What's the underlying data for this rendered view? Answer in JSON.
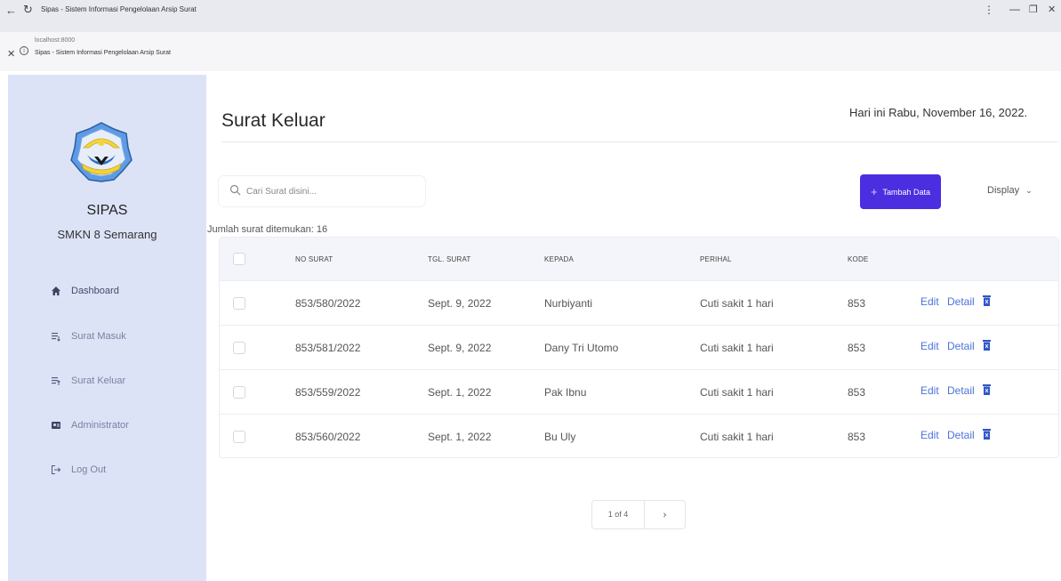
{
  "browser": {
    "tab_title": "Sipas - Sistem Informasi Pengelolaan Arsip Surat",
    "url": "localhost:8000",
    "page_title": "Sipas - Sistem Informasi Pengelolaan Arsip Surat"
  },
  "sidebar": {
    "brand": "SIPAS",
    "school": "SMKN 8 Semarang",
    "items": [
      {
        "label": "Dashboard",
        "icon": "home-icon"
      },
      {
        "label": "Surat Masuk",
        "icon": "inbox-list-icon"
      },
      {
        "label": "Surat Keluar",
        "icon": "outbox-list-icon"
      },
      {
        "label": "Administrator",
        "icon": "admin-icon"
      },
      {
        "label": "Log Out",
        "icon": "logout-icon"
      }
    ]
  },
  "main": {
    "title": "Surat Keluar",
    "date_text": "Hari ini Rabu, November 16, 2022.",
    "search_placeholder": "Cari Surat disini...",
    "add_button": "Tambah Data",
    "display_button": "Display",
    "count_text": "Jumlah surat ditemukan: 16"
  },
  "table": {
    "columns": [
      "NO SURAT",
      "TGL. SURAT",
      "KEPADA",
      "PERIHAL",
      "KODE"
    ],
    "rows": [
      {
        "no": "853/580/2022",
        "tgl": "Sept. 9, 2022",
        "kepada": "Nurbiyanti",
        "perihal": "Cuti sakit 1 hari",
        "kode": "853"
      },
      {
        "no": "853/581/2022",
        "tgl": "Sept. 9, 2022",
        "kepada": "Dany Tri Utomo",
        "perihal": "Cuti sakit 1 hari",
        "kode": "853"
      },
      {
        "no": "853/559/2022",
        "tgl": "Sept. 1, 2022",
        "kepada": "Pak Ibnu",
        "perihal": "Cuti sakit 1 hari",
        "kode": "853"
      },
      {
        "no": "853/560/2022",
        "tgl": "Sept. 1, 2022",
        "kepada": "Bu Uly",
        "perihal": "Cuti sakit 1 hari",
        "kode": "853"
      }
    ],
    "edit_label": "Edit",
    "detail_label": "Detail"
  },
  "pagination": {
    "text": "1 of 4",
    "next": "›"
  },
  "colors": {
    "accent": "#4a2ee0",
    "sidebar_bg": "#dde3f7",
    "link": "#4b73d8"
  }
}
